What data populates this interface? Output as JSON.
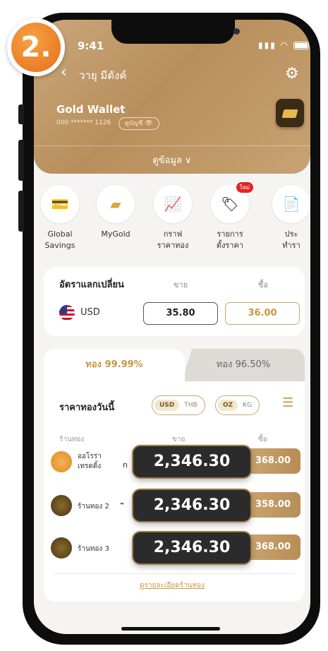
{
  "step_badge": "2.",
  "status": {
    "time": "9:41"
  },
  "header": {
    "back_glyph": "‹",
    "user_name": "วายุ มีตังค์",
    "gear_glyph": "⚙",
    "wallet_title": "Gold Wallet",
    "account_masked": "000 ******* 1126",
    "account_toggle": "ดูบัญชี 👁",
    "info_toggle": "ดูข้อมูล ∨"
  },
  "menu": [
    {
      "label_line1": "Global",
      "label_line2": "Savings",
      "icon": "card-icon",
      "glyph": "💳"
    },
    {
      "label_line1": "MyGold",
      "label_line2": "",
      "icon": "gold-bars-icon",
      "glyph": "▰"
    },
    {
      "label_line1": "กราฟ",
      "label_line2": "ราคาทอง",
      "icon": "chart-icon",
      "glyph": "📈"
    },
    {
      "label_line1": "รายการ",
      "label_line2": "ตั้งราคา",
      "icon": "price-alert-icon",
      "glyph": "🏷",
      "badge": "ใหม่"
    },
    {
      "label_line1": "ประ",
      "label_line2": "ทำรา",
      "icon": "history-icon",
      "glyph": "📄"
    }
  ],
  "exchange": {
    "title": "อัตราแลกเปลี่ยน",
    "sell_header": "ขาย",
    "buy_header": "ซื้อ",
    "currency": "USD",
    "sell_value": "35.80",
    "buy_value": "36.00"
  },
  "tabs": {
    "active": "ทอง 99.99%",
    "inactive": "ทอง 96.50%"
  },
  "today": {
    "title": "ราคาทองวันนี้",
    "currency_options": [
      "USD",
      "THB"
    ],
    "currency_selected": "USD",
    "unit_options": [
      "OZ",
      "KG"
    ],
    "unit_selected": "OZ"
  },
  "table": {
    "col_shop": "ร้านทอง",
    "col_sell": "ขาย",
    "col_buy": "ซื้อ",
    "rows": [
      {
        "shop_line1": "ออโรร่า",
        "shop_line2": "เทรดดิ้ง",
        "sell": "2,346.30",
        "buy": "2,368.00",
        "buy_visible": "368.00"
      },
      {
        "shop_line1": "ร้านทอง 2",
        "shop_line2": "",
        "sell": "2,346.30",
        "buy": "2,358.00",
        "buy_visible": "358.00"
      },
      {
        "shop_line1": "ร้านทอง 3",
        "shop_line2": "",
        "sell": "2,346.30",
        "buy": "2,368.00",
        "buy_visible": "368.00"
      }
    ],
    "row1_truncation": "n",
    "row2_truncation": "ี",
    "footer_link": "ดูรายละเอียดร้านทอง"
  },
  "colors": {
    "gold": "#c9973f",
    "header": "#b88f5c",
    "popup": "#2b2b2b",
    "step": "#e56f1c"
  }
}
